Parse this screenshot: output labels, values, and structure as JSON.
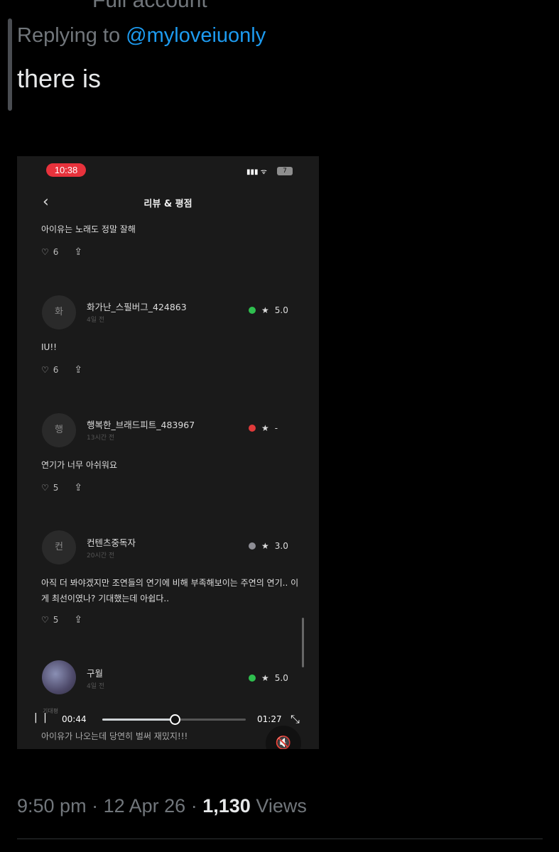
{
  "tweet": {
    "top_cut_text": "Full account",
    "replying_prefix": "Replying to",
    "replying_handle": "@myloveiuonly",
    "text": "there is",
    "time": "9:50 pm",
    "date": "12 Apr 26",
    "views_count": "1,130",
    "views_label": "Views"
  },
  "video": {
    "status": {
      "time": "10:38",
      "battery": "7"
    },
    "nav": {
      "back_icon": "chevron-left",
      "title": "리뷰 & 평점"
    },
    "reviews_partial": {
      "text": "아이유는 노래도 정말 잘해",
      "likes": "6"
    },
    "reviews": [
      {
        "avatar": "화",
        "username": "화가난_스필버그_424863",
        "date": "4일 전",
        "rating": "5.0",
        "dot_color": "#2fbf4f",
        "text": "IU!!",
        "likes": "6"
      },
      {
        "avatar": "행",
        "username": "행복한_브래드피트_483967",
        "date": "13시간 전",
        "rating": "-",
        "dot_color": "#e03a3a",
        "text": "연기가 너무 아쉬워요",
        "likes": "5"
      },
      {
        "avatar": "컨",
        "username": "컨텐츠중독자",
        "date": "20시간 전",
        "rating": "3.0",
        "dot_color": "#8e8e95",
        "text": "아직 더 봐야겠지만 조연들의 연기에 비해 부족해보이는 주연의 연기.. 이게 최선이였나? 기대했는데 아쉽다..",
        "likes": "5"
      },
      {
        "avatar": "",
        "username": "구월",
        "date": "4일 전",
        "rating": "5.0",
        "dot_color": "#2fbf4f"
      }
    ],
    "ghost_label": "기대평",
    "ghost_text": "아이유가 나오는데 당연히 벌써 재밌지!!!",
    "controls": {
      "current_time": "00:44",
      "duration": "01:27",
      "progress": 0.506
    }
  }
}
